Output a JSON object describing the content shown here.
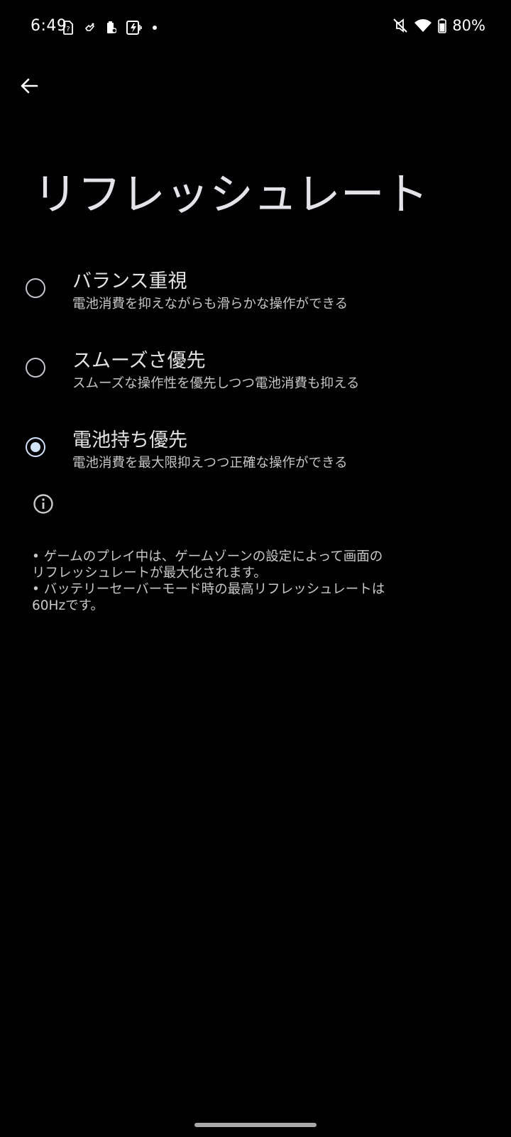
{
  "status_bar": {
    "time": "6:49",
    "battery_level": "80%",
    "left_icons": [
      "sim-question-icon",
      "hand-wave-icon",
      "battery-alert-icon",
      "battery-saver-icon",
      "dot-icon"
    ],
    "right_icons": [
      "vibrate-off-icon",
      "wifi-icon",
      "battery-charging-icon"
    ]
  },
  "header": {
    "back_icon": "arrow-back-icon",
    "title": "リフレッシュレート"
  },
  "options": [
    {
      "title": "バランス重視",
      "summary": "電池消費を抑えながらも滑らかな操作ができる",
      "selected": false
    },
    {
      "title": "スムーズさ優先",
      "summary": "スムーズな操作性を優先しつつ電池消費も抑える",
      "selected": false
    },
    {
      "title": "電池持ち優先",
      "summary": "電池消費を最大限抑えつつ正確な操作ができる",
      "selected": true
    }
  ],
  "footer": {
    "info_icon": "info-icon",
    "lines": [
      "• ゲームのプレイ中は、ゲームゾーンの設定によって画面の\nリフレッシュレートが最大化されます。",
      "• バッテリーセーバーモード時の最高リフレッシュレートは\n60Hzです。"
    ]
  },
  "colors": {
    "background": "#000000",
    "text_primary": "#e3e3e3",
    "text_secondary": "#c6c6c6",
    "radio_selected": "#d2e3fc",
    "radio_unselected": "#c7c6ca"
  }
}
